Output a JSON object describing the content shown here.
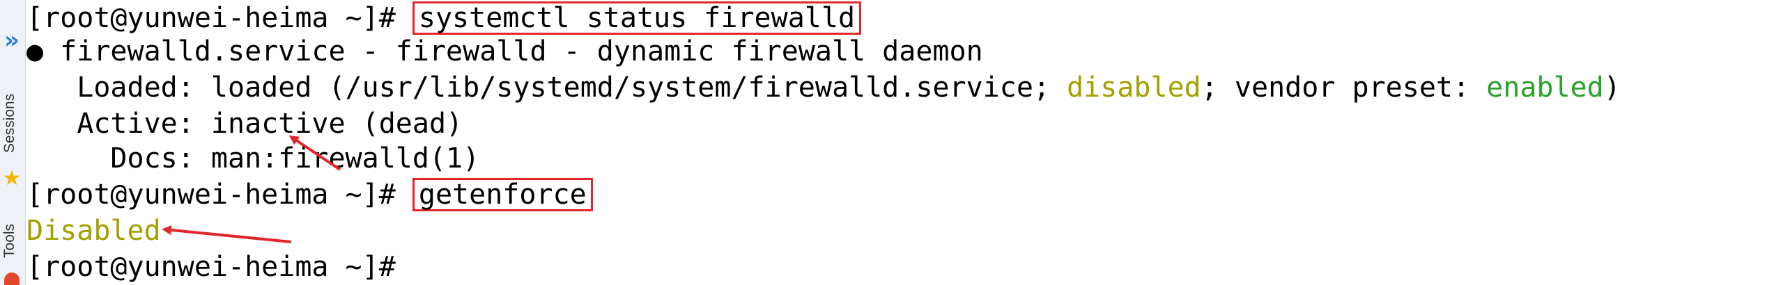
{
  "sidebar": {
    "sessions_label": "Sessions",
    "tools_label": "Tools",
    "icons": [
      "double-chevron-right-icon",
      "star-icon",
      "tools-icon"
    ]
  },
  "terminal": {
    "prompt": "[root@yunwei-heima ~]# ",
    "line1": {
      "command": "systemctl status firewalld"
    },
    "line2": {
      "text": "● firewalld.service - firewalld - dynamic firewall daemon"
    },
    "line3": {
      "prefix": "   Loaded: loaded (/usr/lib/systemd/system/firewalld.service; ",
      "disabled": "disabled",
      "middle": "; vendor preset: ",
      "enabled": "enabled",
      "suffix": ")"
    },
    "line4": {
      "text": "   Active: inactive (dead)"
    },
    "line5": {
      "text": "     Docs: man:firewalld(1)"
    },
    "line6": {
      "command": "getenforce"
    },
    "line7": {
      "text": "Disabled"
    }
  },
  "colors": {
    "highlight_box": "#e3262b",
    "annotation_arrow": "#e3262b",
    "olive_text": "#a3a000",
    "green_text": "#2aa12a",
    "sidebar_arrow": "#2f7fd8"
  }
}
